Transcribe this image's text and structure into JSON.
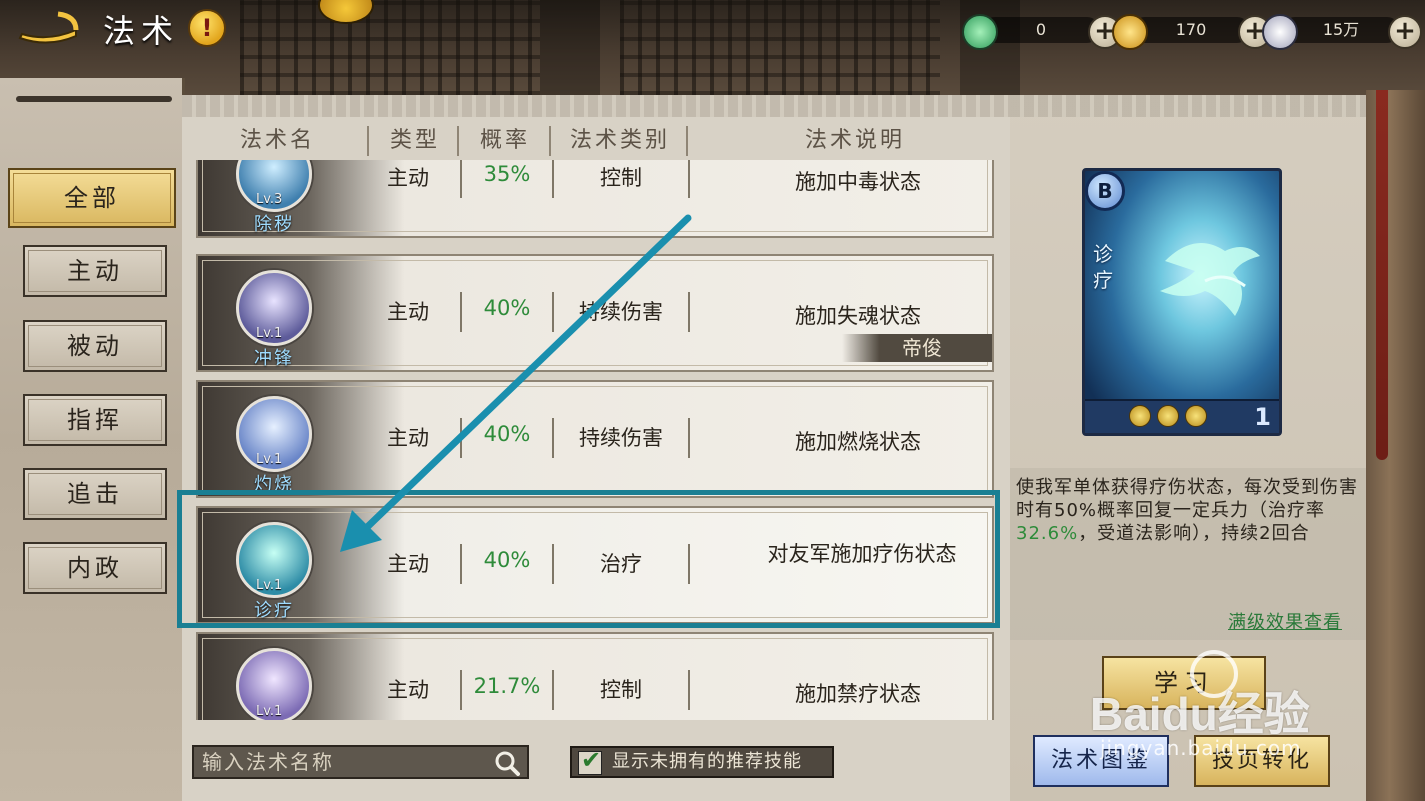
{
  "header": {
    "title": "法术",
    "resources": [
      {
        "name": "jade",
        "value": "0",
        "icon": "jade-coin-icon",
        "color": "#4bbf7a"
      },
      {
        "name": "copper",
        "value": "170",
        "icon": "copper-coin-icon",
        "color": "#e2b13a"
      },
      {
        "name": "silver",
        "value": "15万",
        "icon": "silver-coin-icon",
        "color": "#d8d8e6"
      }
    ]
  },
  "nav": {
    "tabs": [
      "全部",
      "主动",
      "被动",
      "指挥",
      "追击",
      "内政"
    ],
    "active": "全部"
  },
  "table": {
    "columns": [
      "法术名",
      "类型",
      "概率",
      "法术类别",
      "法术说明"
    ],
    "rows": [
      {
        "name": "除秽",
        "level": "Lv.3",
        "type": "主动",
        "rate": "35%",
        "category": "控制",
        "desc": "施加中毒状态",
        "hero": ""
      },
      {
        "name": "冲锋",
        "level": "Lv.1",
        "type": "主动",
        "rate": "40%",
        "category": "持续伤害",
        "desc": "施加失魂状态",
        "hero": "帝俊"
      },
      {
        "name": "灼烧",
        "level": "Lv.1",
        "type": "主动",
        "rate": "40%",
        "category": "持续伤害",
        "desc": "施加燃烧状态",
        "hero": ""
      },
      {
        "name": "诊疗",
        "level": "Lv.1",
        "type": "主动",
        "rate": "40%",
        "category": "治疗",
        "desc": "对友军施加疗伤状态",
        "hero": ""
      },
      {
        "name": "",
        "level": "Lv.1",
        "type": "主动",
        "rate": "21.7%",
        "category": "控制",
        "desc": "施加禁疗状态",
        "hero": ""
      }
    ]
  },
  "search": {
    "placeholder": "输入法术名称"
  },
  "toggle": {
    "label": "显示未拥有的推荐技能",
    "checked": true
  },
  "detail": {
    "grade": "B",
    "card_name": "诊疗",
    "count": "1",
    "desc_part1": "使我军单体获得疗伤状态，每次受到伤害时有50%概率回复一定兵力（治疗率",
    "desc_highlight": "32.6%",
    "desc_part2": "，受道法影响），持续2回合",
    "max_link": "满级效果查看",
    "learn": "学习",
    "atlas": "法术图鉴",
    "convert": "技页转化"
  },
  "watermark": {
    "brand": "Baidu经验",
    "site": "jingyan.baidu.com"
  }
}
